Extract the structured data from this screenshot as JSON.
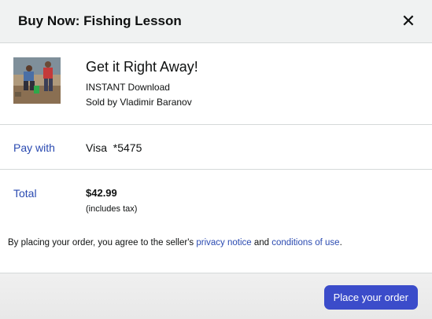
{
  "header": {
    "title": "Buy Now: Fishing Lesson",
    "close_glyph": "✕"
  },
  "product": {
    "headline": "Get it Right Away!",
    "format": "INSTANT Download",
    "seller": "Sold by Vladimir Baranov",
    "image_icon": "product-thumbnail"
  },
  "payment": {
    "label": "Pay with",
    "method": "Visa  *5475"
  },
  "total": {
    "label": "Total",
    "amount": "$42.99",
    "note": "(includes tax)"
  },
  "agreement": {
    "prefix": "By placing your order, you agree to the seller's ",
    "privacy_link": "privacy notice",
    "middle": " and ",
    "conditions_link": "conditions of use",
    "suffix": "."
  },
  "footer": {
    "place_order_label": "Place your order"
  },
  "colors": {
    "accent": "#3b4cca",
    "link": "#2a4ab1",
    "header_bg": "#f0f2f2"
  }
}
